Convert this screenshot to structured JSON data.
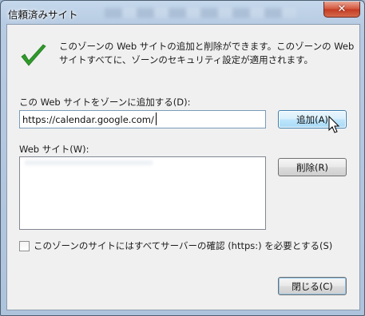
{
  "window": {
    "title": "信頼済みサイト",
    "close_glyph": "✕"
  },
  "info": {
    "icon": "checkmark-icon",
    "text": "このゾーンの Web サイトの追加と削除ができます。このゾーンの Web サイトすべてに、ゾーンのセキュリティ設定が適用されます。"
  },
  "add_section": {
    "label": "この Web サイトをゾーンに追加する(D):",
    "url_value": "https://calendar.google.com/",
    "add_button": "追加(A)"
  },
  "sites_section": {
    "label": "Web サイト(W):",
    "remove_button": "削除(R)"
  },
  "https_option": {
    "label": "このゾーンのサイトにはすべてサーバーの確認 (https:) を必要とする(S)",
    "checked": false
  },
  "footer": {
    "close_button": "閉じる(C)"
  },
  "colors": {
    "check_green": "#2f9a2b",
    "title_glass": "#b7cbe2",
    "close_red": "#c23b22"
  }
}
